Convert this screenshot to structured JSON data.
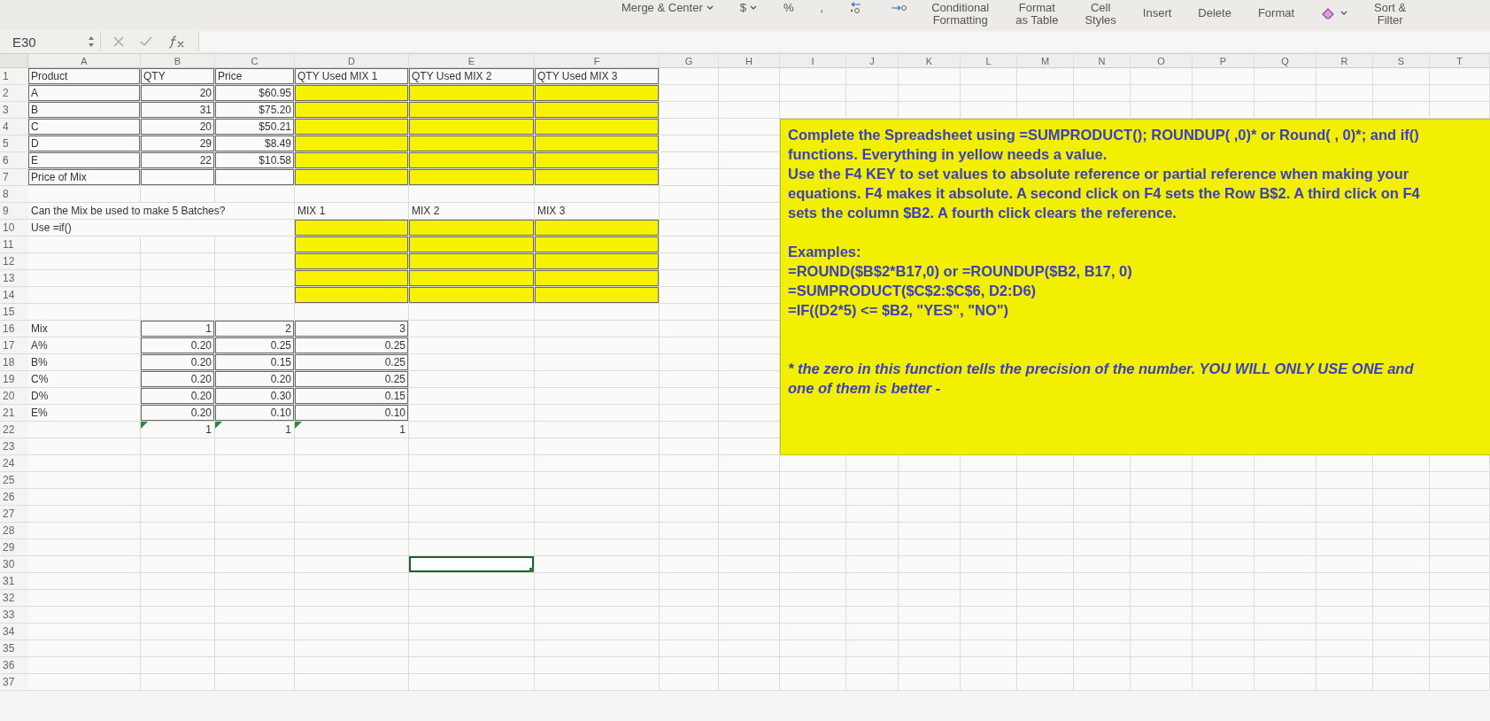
{
  "ribbon": {
    "items": [
      {
        "kind": "dropdown",
        "label": "Merge & Center"
      },
      {
        "kind": "dropdown",
        "label": "$"
      },
      {
        "kind": "symbol",
        "label": "%"
      },
      {
        "kind": "symbol",
        "label": ","
      },
      {
        "kind": "increase-decimal"
      },
      {
        "kind": "decrease-decimal"
      },
      {
        "kind": "stacked",
        "lines": [
          "Conditional",
          "Formatting"
        ]
      },
      {
        "kind": "stacked",
        "lines": [
          "Format",
          "as Table"
        ]
      },
      {
        "kind": "stacked",
        "lines": [
          "Cell",
          "Styles"
        ]
      },
      {
        "kind": "label",
        "label": "Insert"
      },
      {
        "kind": "label",
        "label": "Delete"
      },
      {
        "kind": "label",
        "label": "Format"
      },
      {
        "kind": "eraser-dropdown"
      },
      {
        "kind": "stacked",
        "lines": [
          "Sort &",
          "Filter"
        ]
      }
    ]
  },
  "formula_bar": {
    "name_box": "E30"
  },
  "sheet": {
    "columns": [
      "A",
      "B",
      "C",
      "D",
      "E",
      "F",
      "G",
      "H",
      "I",
      "J",
      "K",
      "L",
      "M",
      "N",
      "O",
      "P",
      "Q",
      "R",
      "S",
      "T"
    ],
    "rows": [
      {
        "number": "1",
        "cells": [
          {
            "kind": "text",
            "text": "Product",
            "bordered": true,
            "highlighted": false,
            "flagged": false,
            "selected": false
          },
          {
            "kind": "text",
            "text": "QTY",
            "bordered": true,
            "highlighted": false,
            "flagged": false,
            "selected": false
          },
          {
            "kind": "text",
            "text": "Price",
            "bordered": true,
            "highlighted": false,
            "flagged": false,
            "selected": false
          },
          {
            "kind": "text",
            "text": "QTY Used MIX 1",
            "bordered": true,
            "highlighted": false,
            "flagged": false,
            "selected": false
          },
          {
            "kind": "text",
            "text": "QTY Used MIX 2",
            "bordered": true,
            "highlighted": false,
            "flagged": false,
            "selected": false
          },
          {
            "kind": "text",
            "text": "QTY Used MIX 3",
            "bordered": true,
            "highlighted": false,
            "flagged": false,
            "selected": false
          }
        ]
      },
      {
        "number": "2",
        "cells": [
          {
            "kind": "text",
            "text": "A",
            "bordered": true,
            "highlighted": false,
            "flagged": false,
            "selected": false
          },
          {
            "kind": "number",
            "text": "20",
            "bordered": true,
            "highlighted": false,
            "flagged": false,
            "selected": false
          },
          {
            "kind": "number",
            "text": "$60.95",
            "bordered": true,
            "highlighted": false,
            "flagged": false,
            "selected": false
          },
          {
            "kind": "text",
            "bordered": true,
            "highlighted": true,
            "flagged": false,
            "selected": false
          },
          {
            "kind": "text",
            "bordered": true,
            "highlighted": true,
            "flagged": false,
            "selected": false
          },
          {
            "kind": "text",
            "bordered": true,
            "highlighted": true,
            "flagged": false,
            "selected": false
          }
        ]
      },
      {
        "number": "3",
        "cells": [
          {
            "kind": "text",
            "text": "B",
            "bordered": true,
            "highlighted": false,
            "flagged": false,
            "selected": false
          },
          {
            "kind": "number",
            "text": "31",
            "bordered": true,
            "highlighted": false,
            "flagged": false,
            "selected": false
          },
          {
            "kind": "number",
            "text": "$75.20",
            "bordered": true,
            "highlighted": false,
            "flagged": false,
            "selected": false
          },
          {
            "kind": "text",
            "bordered": true,
            "highlighted": true,
            "flagged": false,
            "selected": false
          },
          {
            "kind": "text",
            "bordered": true,
            "highlighted": true,
            "flagged": false,
            "selected": false
          },
          {
            "kind": "text",
            "bordered": true,
            "highlighted": true,
            "flagged": false,
            "selected": false
          }
        ]
      },
      {
        "number": "4",
        "cells": [
          {
            "kind": "text",
            "text": "C",
            "bordered": true,
            "highlighted": false,
            "flagged": false,
            "selected": false
          },
          {
            "kind": "number",
            "text": "20",
            "bordered": true,
            "highlighted": false,
            "flagged": false,
            "selected": false
          },
          {
            "kind": "number",
            "text": "$50.21",
            "bordered": true,
            "highlighted": false,
            "flagged": false,
            "selected": false
          },
          {
            "kind": "text",
            "bordered": true,
            "highlighted": true,
            "flagged": false,
            "selected": false
          },
          {
            "kind": "text",
            "bordered": true,
            "highlighted": true,
            "flagged": false,
            "selected": false
          },
          {
            "kind": "text",
            "bordered": true,
            "highlighted": true,
            "flagged": false,
            "selected": false
          }
        ]
      },
      {
        "number": "5",
        "cells": [
          {
            "kind": "text",
            "text": "D",
            "bordered": true,
            "highlighted": false,
            "flagged": false,
            "selected": false
          },
          {
            "kind": "number",
            "text": "29",
            "bordered": true,
            "highlighted": false,
            "flagged": false,
            "selected": false
          },
          {
            "kind": "number",
            "text": "$8.49",
            "bordered": true,
            "highlighted": false,
            "flagged": false,
            "selected": false
          },
          {
            "kind": "text",
            "bordered": true,
            "highlighted": true,
            "flagged": false,
            "selected": false
          },
          {
            "kind": "text",
            "bordered": true,
            "highlighted": true,
            "flagged": false,
            "selected": false
          },
          {
            "kind": "text",
            "bordered": true,
            "highlighted": true,
            "flagged": false,
            "selected": false
          }
        ]
      },
      {
        "number": "6",
        "cells": [
          {
            "kind": "text",
            "text": "E",
            "bordered": true,
            "highlighted": false,
            "flagged": false,
            "selected": false
          },
          {
            "kind": "number",
            "text": "22",
            "bordered": true,
            "highlighted": false,
            "flagged": false,
            "selected": false
          },
          {
            "kind": "number",
            "text": "$10.58",
            "bordered": true,
            "highlighted": false,
            "flagged": false,
            "selected": false
          },
          {
            "kind": "text",
            "bordered": true,
            "highlighted": true,
            "flagged": false,
            "selected": false
          },
          {
            "kind": "text",
            "bordered": true,
            "highlighted": true,
            "flagged": false,
            "selected": false
          },
          {
            "kind": "text",
            "bordered": true,
            "highlighted": true,
            "flagged": false,
            "selected": false
          }
        ]
      },
      {
        "number": "7",
        "cells": [
          {
            "kind": "text",
            "text": "Price of Mix",
            "bordered": true,
            "highlighted": false,
            "flagged": false,
            "selected": false
          },
          {
            "kind": "text",
            "bordered": true,
            "highlighted": false,
            "flagged": false,
            "selected": false
          },
          {
            "kind": "text",
            "bordered": true,
            "highlighted": false,
            "flagged": false,
            "selected": false
          },
          {
            "kind": "text",
            "bordered": true,
            "highlighted": true,
            "flagged": false,
            "selected": false
          },
          {
            "kind": "text",
            "bordered": true,
            "highlighted": true,
            "flagged": false,
            "selected": false
          },
          {
            "kind": "text",
            "bordered": true,
            "highlighted": true,
            "flagged": false,
            "selected": false
          }
        ]
      },
      {
        "number": "8"
      },
      {
        "number": "9",
        "cells": [
          {
            "kind": "text",
            "text": "Can the Mix be used to make 5 Batches?",
            "bordered": false,
            "highlighted": false,
            "flagged": false,
            "selected": false
          },
          null,
          null,
          {
            "kind": "text",
            "text": "MIX 1",
            "bordered": false,
            "highlighted": false,
            "flagged": false,
            "selected": false
          },
          {
            "kind": "text",
            "text": "MIX 2",
            "bordered": false,
            "highlighted": false,
            "flagged": false,
            "selected": false
          },
          {
            "kind": "text",
            "text": "MIX 3",
            "bordered": false,
            "highlighted": false,
            "flagged": false,
            "selected": false
          }
        ]
      },
      {
        "number": "10",
        "cells": [
          {
            "kind": "text",
            "text": "Use =if()",
            "bordered": false,
            "highlighted": false,
            "flagged": false,
            "selected": false
          },
          null,
          null,
          {
            "kind": "text",
            "bordered": true,
            "highlighted": true,
            "flagged": false,
            "selected": false
          },
          {
            "kind": "text",
            "bordered": true,
            "highlighted": true,
            "flagged": false,
            "selected": false
          },
          {
            "kind": "text",
            "bordered": true,
            "highlighted": true,
            "flagged": false,
            "selected": false
          }
        ]
      },
      {
        "number": "11",
        "cells": [
          {
            "kind": "text",
            "bordered": false,
            "highlighted": false,
            "flagged": false,
            "selected": false
          },
          {
            "kind": "text",
            "bordered": false,
            "highlighted": false,
            "flagged": false,
            "selected": false
          },
          {
            "kind": "text",
            "bordered": false,
            "highlighted": false,
            "flagged": false,
            "selected": false
          },
          {
            "kind": "text",
            "bordered": true,
            "highlighted": true,
            "flagged": false,
            "selected": false
          },
          {
            "kind": "text",
            "bordered": true,
            "highlighted": true,
            "flagged": false,
            "selected": false
          },
          {
            "kind": "text",
            "bordered": true,
            "highlighted": true,
            "flagged": false,
            "selected": false
          }
        ]
      },
      {
        "number": "12",
        "cells": [
          {
            "kind": "text",
            "bordered": false,
            "highlighted": false,
            "flagged": false,
            "selected": false
          },
          {
            "kind": "text",
            "bordered": false,
            "highlighted": false,
            "flagged": false,
            "selected": false
          },
          {
            "kind": "text",
            "bordered": false,
            "highlighted": false,
            "flagged": false,
            "selected": false
          },
          {
            "kind": "text",
            "bordered": true,
            "highlighted": true,
            "flagged": false,
            "selected": false
          },
          {
            "kind": "text",
            "bordered": true,
            "highlighted": true,
            "flagged": false,
            "selected": false
          },
          {
            "kind": "text",
            "bordered": true,
            "highlighted": true,
            "flagged": false,
            "selected": false
          }
        ]
      },
      {
        "number": "13",
        "cells": [
          {
            "kind": "text",
            "bordered": false,
            "highlighted": false,
            "flagged": false,
            "selected": false
          },
          {
            "kind": "text",
            "bordered": false,
            "highlighted": false,
            "flagged": false,
            "selected": false
          },
          {
            "kind": "text",
            "bordered": false,
            "highlighted": false,
            "flagged": false,
            "selected": false
          },
          {
            "kind": "text",
            "bordered": true,
            "highlighted": true,
            "flagged": false,
            "selected": false
          },
          {
            "kind": "text",
            "bordered": true,
            "highlighted": true,
            "flagged": false,
            "selected": false
          },
          {
            "kind": "text",
            "bordered": true,
            "highlighted": true,
            "flagged": false,
            "selected": false
          }
        ]
      },
      {
        "number": "14",
        "cells": [
          {
            "kind": "text",
            "bordered": false,
            "highlighted": false,
            "flagged": false,
            "selected": false
          },
          {
            "kind": "text",
            "bordered": false,
            "highlighted": false,
            "flagged": false,
            "selected": false
          },
          {
            "kind": "text",
            "bordered": false,
            "highlighted": false,
            "flagged": false,
            "selected": false
          },
          {
            "kind": "text",
            "bordered": true,
            "highlighted": true,
            "flagged": false,
            "selected": false
          },
          {
            "kind": "text",
            "bordered": true,
            "highlighted": true,
            "flagged": false,
            "selected": false
          },
          {
            "kind": "text",
            "bordered": true,
            "highlighted": true,
            "flagged": false,
            "selected": false
          }
        ]
      },
      {
        "number": "15"
      },
      {
        "number": "16",
        "cells": [
          {
            "kind": "text",
            "text": "Mix",
            "bordered": false,
            "highlighted": false,
            "flagged": false,
            "selected": false
          },
          {
            "kind": "number",
            "text": "1",
            "bordered": true,
            "highlighted": false,
            "flagged": false,
            "selected": false
          },
          {
            "kind": "number",
            "text": "2",
            "bordered": true,
            "highlighted": false,
            "flagged": false,
            "selected": false
          },
          {
            "kind": "number",
            "text": "3",
            "bordered": true,
            "highlighted": false,
            "flagged": false,
            "selected": false
          }
        ]
      },
      {
        "number": "17",
        "cells": [
          {
            "kind": "text",
            "text": "A%",
            "bordered": false,
            "highlighted": false,
            "flagged": false,
            "selected": false
          },
          {
            "kind": "number",
            "text": "0.20",
            "bordered": true,
            "highlighted": false,
            "flagged": false,
            "selected": false
          },
          {
            "kind": "number",
            "text": "0.25",
            "bordered": true,
            "highlighted": false,
            "flagged": false,
            "selected": false
          },
          {
            "kind": "number",
            "text": "0.25",
            "bordered": true,
            "highlighted": false,
            "flagged": false,
            "selected": false
          }
        ]
      },
      {
        "number": "18",
        "cells": [
          {
            "kind": "text",
            "text": "B%",
            "bordered": false,
            "highlighted": false,
            "flagged": false,
            "selected": false
          },
          {
            "kind": "number",
            "text": "0.20",
            "bordered": true,
            "highlighted": false,
            "flagged": false,
            "selected": false
          },
          {
            "kind": "number",
            "text": "0.15",
            "bordered": true,
            "highlighted": false,
            "flagged": false,
            "selected": false
          },
          {
            "kind": "number",
            "text": "0.25",
            "bordered": true,
            "highlighted": false,
            "flagged": false,
            "selected": false
          }
        ]
      },
      {
        "number": "19",
        "cells": [
          {
            "kind": "text",
            "text": "C%",
            "bordered": false,
            "highlighted": false,
            "flagged": false,
            "selected": false
          },
          {
            "kind": "number",
            "text": "0.20",
            "bordered": true,
            "highlighted": false,
            "flagged": false,
            "selected": false
          },
          {
            "kind": "number",
            "text": "0.20",
            "bordered": true,
            "highlighted": false,
            "flagged": false,
            "selected": false
          },
          {
            "kind": "number",
            "text": "0.25",
            "bordered": true,
            "highlighted": false,
            "flagged": false,
            "selected": false
          }
        ]
      },
      {
        "number": "20",
        "cells": [
          {
            "kind": "text",
            "text": "D%",
            "bordered": false,
            "highlighted": false,
            "flagged": false,
            "selected": false
          },
          {
            "kind": "number",
            "text": "0.20",
            "bordered": true,
            "highlighted": false,
            "flagged": false,
            "selected": false
          },
          {
            "kind": "number",
            "text": "0.30",
            "bordered": true,
            "highlighted": false,
            "flagged": false,
            "selected": false
          },
          {
            "kind": "number",
            "text": "0.15",
            "bordered": true,
            "highlighted": false,
            "flagged": false,
            "selected": false
          }
        ]
      },
      {
        "number": "21",
        "cells": [
          {
            "kind": "text",
            "text": "E%",
            "bordered": false,
            "highlighted": false,
            "flagged": false,
            "selected": false
          },
          {
            "kind": "number",
            "text": "0.20",
            "bordered": true,
            "highlighted": false,
            "flagged": false,
            "selected": false
          },
          {
            "kind": "number",
            "text": "0.10",
            "bordered": true,
            "highlighted": false,
            "flagged": false,
            "selected": false
          },
          {
            "kind": "number",
            "text": "0.10",
            "bordered": true,
            "highlighted": false,
            "flagged": false,
            "selected": false
          }
        ]
      },
      {
        "number": "22",
        "cells": [
          {
            "kind": "text",
            "bordered": false,
            "highlighted": false,
            "flagged": false,
            "selected": false
          },
          {
            "kind": "number",
            "text": "1",
            "bordered": false,
            "highlighted": false,
            "flagged": true,
            "selected": false
          },
          {
            "kind": "number",
            "text": "1",
            "bordered": false,
            "highlighted": false,
            "flagged": true,
            "selected": false
          },
          {
            "kind": "number",
            "text": "1",
            "bordered": false,
            "highlighted": false,
            "flagged": true,
            "selected": false
          }
        ]
      },
      {
        "number": "23"
      },
      {
        "number": "24"
      },
      {
        "number": "25"
      },
      {
        "number": "26"
      },
      {
        "number": "27"
      },
      {
        "number": "28"
      },
      {
        "number": "29"
      },
      {
        "number": "30",
        "cells": [
          {
            "kind": "text",
            "bordered": false,
            "highlighted": false,
            "flagged": false,
            "selected": false
          },
          {
            "kind": "text",
            "bordered": false,
            "highlighted": false,
            "flagged": false,
            "selected": false
          },
          {
            "kind": "text",
            "bordered": false,
            "highlighted": false,
            "flagged": false,
            "selected": false
          },
          {
            "kind": "text",
            "bordered": false,
            "highlighted": false,
            "flagged": false,
            "selected": false
          },
          {
            "kind": "text",
            "bordered": false,
            "highlighted": false,
            "flagged": false,
            "selected": true
          }
        ]
      },
      {
        "number": "31"
      },
      {
        "number": "32"
      },
      {
        "number": "33"
      },
      {
        "number": "34"
      },
      {
        "number": "35"
      },
      {
        "number": "36"
      },
      {
        "number": "37"
      }
    ]
  },
  "text_box": {
    "paragraphs": [
      {
        "kind": "instruction",
        "text": "Complete the Spreadsheet using =SUMPRODUCT(); ROUNDUP( ,0)* or Round( , 0)*; and if() functions.  Everything in yellow needs a value."
      },
      {
        "kind": "instruction",
        "text": "Use the F4 KEY to set values to absolute reference or partial reference when making your equations. F4 makes it absolute. A second click on F4 sets the Row B$2. A third click on F4 sets the column $B2.  A fourth click clears the reference."
      },
      {
        "kind": "heading",
        "text": "Examples:"
      },
      {
        "kind": "example",
        "text": "=ROUND($B$2*B17,0)    or    =ROUNDUP($B2, B17, 0)"
      },
      {
        "kind": "example",
        "text": "=SUMPRODUCT($C$2:$C$6, D2:D6)"
      },
      {
        "kind": "example",
        "text": "=IF((D2*5) <= $B2, \"YES\", \"NO\")"
      },
      {
        "kind": "note",
        "text": "* the zero in this function tells the precision of the number.  YOU WILL ONLY USE ONE and one of them is better -"
      }
    ]
  }
}
